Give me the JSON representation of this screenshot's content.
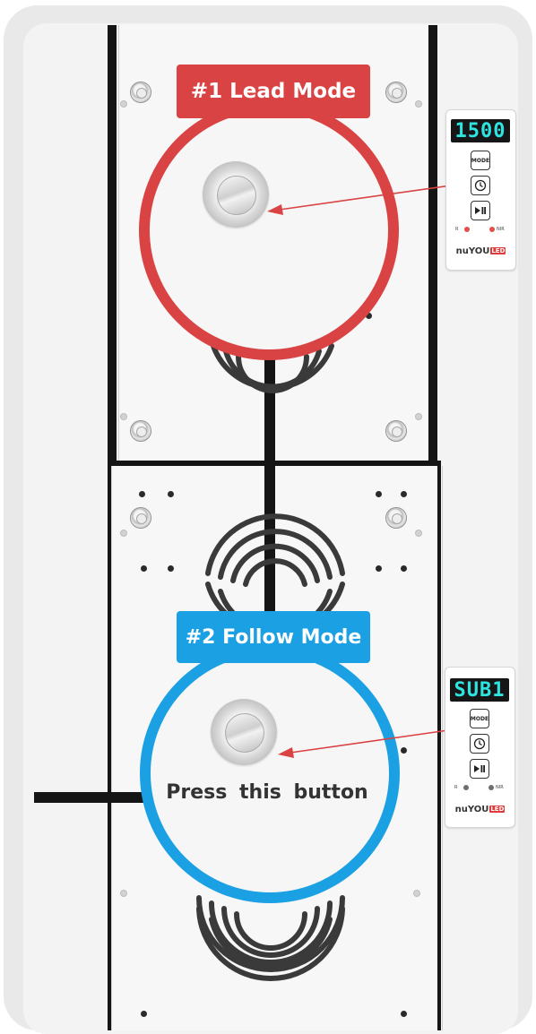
{
  "lead": {
    "label": "#1 Lead Mode",
    "color": "#d94343"
  },
  "follow": {
    "label": "#2 Follow Mode",
    "color": "#1aa0e3",
    "instruction": "Press this button"
  },
  "controller_top": {
    "display": "1500",
    "buttons": [
      "MODE",
      "timer-icon",
      "play-pause-icon"
    ],
    "led_labels": [
      "R",
      "NIR"
    ],
    "brand": "nuYOU",
    "brand_badge": "LED"
  },
  "controller_bottom": {
    "display": "SUB1",
    "buttons": [
      "MODE",
      "timer-icon",
      "play-pause-icon"
    ],
    "led_labels": [
      "R",
      "NIR"
    ],
    "brand": "nuYOU",
    "brand_badge": "LED"
  },
  "colors": {
    "rail": "#151515",
    "arrow": "#d94343",
    "lcd_text": "#2fe4e0",
    "frame": "#e9e9e9"
  }
}
